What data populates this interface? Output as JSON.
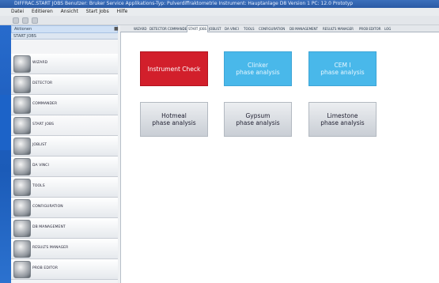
{
  "titlebar": {
    "text": "DIFFRAC.START JOBS   Benutzer: Bruker Service   Applikations-Typ: Pulverdiffraktometrie   Instrument: Hauptanlage D8   Version 1 PC: 12.0 Prototyp"
  },
  "menubar": {
    "items": [
      "Datei",
      "Editieren",
      "Ansicht",
      "Start Jobs",
      "Hilfe"
    ]
  },
  "sidebar": {
    "header": "Aktionen",
    "subheader": "START JOBS",
    "items": [
      {
        "label": "WIZARD",
        "icon": "wizard-icon"
      },
      {
        "label": "DETECTOR",
        "icon": "detector-icon"
      },
      {
        "label": "COMMANDER",
        "icon": "commander-icon"
      },
      {
        "label": "START JOBS",
        "icon": "start-jobs-icon"
      },
      {
        "label": "JOBLIST",
        "icon": "joblist-icon"
      },
      {
        "label": "DA VINCI",
        "icon": "davinci-icon"
      },
      {
        "label": "TOOLS",
        "icon": "tools-icon"
      },
      {
        "label": "CONFIGURATION",
        "icon": "configuration-icon"
      },
      {
        "label": "DB MANAGEMENT",
        "icon": "db-management-icon"
      },
      {
        "label": "RESULTS MANAGER",
        "icon": "results-manager-icon"
      },
      {
        "label": "PROB EDITOR",
        "icon": "prob-editor-icon"
      }
    ]
  },
  "tabs": [
    "WIZARD",
    "DETECTOR",
    "COMMANDER",
    "START JOBS",
    "JOBLIST",
    "DA VINCI",
    "TOOLS",
    "CONFIGURATION",
    "DB MANAGEMENT",
    "RESULTS MANAGER",
    "PROB EDITOR",
    "LOG"
  ],
  "active_tab": "START JOBS",
  "buttons": [
    {
      "label": "Instrument Check",
      "style": "red"
    },
    {
      "label": "Clinker\nphase analysis",
      "style": "blue"
    },
    {
      "label": "CEM I\nphase analysis",
      "style": "blue"
    },
    {
      "label": "Hotmeal\nphase analysis",
      "style": "gray"
    },
    {
      "label": "Gypsum\nphase analysis",
      "style": "gray"
    },
    {
      "label": "Limestone\nphase analysis",
      "style": "gray"
    }
  ],
  "colors": {
    "red": "#d21f2b",
    "blue": "#49b8ea",
    "gray": "#d9dde2",
    "accent": "#2a6fd0"
  }
}
